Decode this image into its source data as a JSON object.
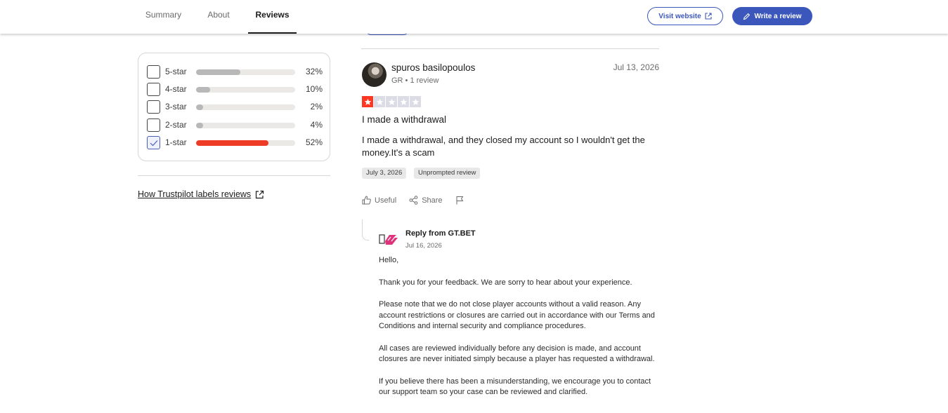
{
  "nav": {
    "tabs": [
      {
        "label": "Summary",
        "active": false
      },
      {
        "label": "About",
        "active": false
      },
      {
        "label": "Reviews",
        "active": true
      }
    ],
    "visit_website_label": "Visit website",
    "write_review_label": "Write a review"
  },
  "colors": {
    "brand_blue": "#3c57bc",
    "one_star_red": "#ee3b25",
    "bar_gray": "#b8b8b8"
  },
  "filters": [
    {
      "label": "5-star",
      "percent": 32,
      "percent_text": "32%",
      "checked": false
    },
    {
      "label": "4-star",
      "percent": 10,
      "percent_text": "10%",
      "checked": false
    },
    {
      "label": "3-star",
      "percent": 2,
      "percent_text": "2%",
      "checked": false
    },
    {
      "label": "2-star",
      "percent": 4,
      "percent_text": "4%",
      "checked": false
    },
    {
      "label": "1-star",
      "percent": 52,
      "percent_text": "52%",
      "checked": true
    }
  ],
  "labels_link": "How Trustpilot labels reviews",
  "review": {
    "reviewer_name": "spuros basilopoulos",
    "reviewer_meta": "GR • 1 review",
    "date": "Jul 13, 2026",
    "rating": 1,
    "rating_max": 5,
    "title": "I made a withdrawal",
    "body": "I made a withdrawal, and they closed my account so I wouldn't get the money.It's a scam",
    "experience_date": "July 3, 2026",
    "badge": "Unprompted review",
    "actions": {
      "useful": "Useful",
      "share": "Share"
    }
  },
  "reply": {
    "from": "Reply from GT.BET",
    "date": "Jul 16, 2026",
    "paragraphs": [
      "Hello,",
      "Thank you for your feedback. We are sorry to hear about your experience.",
      "Please note that we do not close player accounts without a valid reason. Any account restrictions or closures are carried out in accordance with our Terms and Conditions and internal security and compliance procedures.",
      "All cases are reviewed individually before any decision is made, and account closures are never initiated simply because a player has requested a withdrawal.",
      "If you believe there has been a misunderstanding, we encourage you to contact our support team so your case can be reviewed and clarified."
    ]
  }
}
